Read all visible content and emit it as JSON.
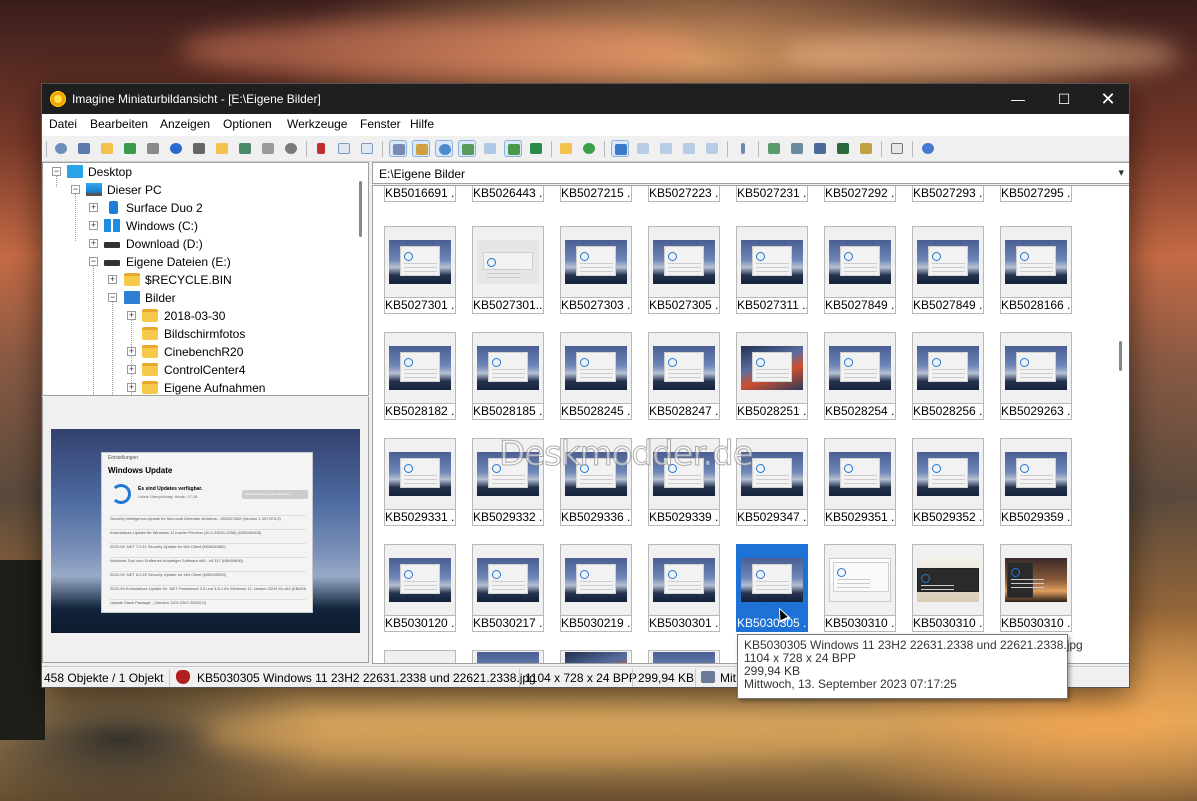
{
  "window": {
    "title": "Imagine Miniaturbildansicht - [E:\\Eigene Bilder]",
    "controls": {
      "minimize": "—",
      "maximize": "☐",
      "close": "✕"
    }
  },
  "menu": [
    "Datei",
    "Bearbeiten",
    "Anzeigen",
    "Optionen",
    "Werkzeuge",
    "Fenster",
    "Hilfe"
  ],
  "toolbar_icons": [
    "view-icon",
    "slideshow-icon",
    "open-folder-icon",
    "save-icon",
    "print-icon",
    "info-icon",
    "camera-icon",
    "folder-add-icon",
    "scan-icon",
    "bin-icon",
    "settings-icon",
    "cut-icon",
    "copy-icon",
    "paste-icon",
    "thumbnails-icon",
    "sort-icon",
    "clock-icon",
    "filter-icon",
    "grid-icon",
    "frame-icon",
    "view-mode-icon",
    "folder-up-icon",
    "refresh-icon",
    "large-thumbs-icon",
    "small-thumbs-icon",
    "list-icon",
    "details-icon",
    "report-icon",
    "tools-icon",
    "batch-icon",
    "batch-convert-icon",
    "capture-icon",
    "film-icon",
    "edit-icon",
    "notes-icon",
    "help-icon"
  ],
  "tree": {
    "items": [
      {
        "label": "Desktop",
        "icon": "desktop-icon",
        "expander": "−"
      },
      {
        "label": "Dieser PC",
        "icon": "pc-icon",
        "expander": "−"
      },
      {
        "label": "Surface Duo 2",
        "icon": "phone-icon",
        "expander": "+"
      },
      {
        "label": "Windows (C:)",
        "icon": "windows-drive-icon",
        "expander": "+"
      },
      {
        "label": "Download (D:)",
        "icon": "drive-icon",
        "expander": "+"
      },
      {
        "label": "Eigene Dateien (E:)",
        "icon": "drive-icon",
        "expander": "−"
      },
      {
        "label": "$RECYCLE.BIN",
        "icon": "folder-icon",
        "expander": "+"
      },
      {
        "label": "Bilder",
        "icon": "pictures-folder-icon",
        "expander": "−"
      },
      {
        "label": "2018-03-30",
        "icon": "folder-icon",
        "expander": "+"
      },
      {
        "label": "Bildschirmfotos",
        "icon": "folder-icon",
        "expander": ""
      },
      {
        "label": "CinebenchR20",
        "icon": "folder-icon",
        "expander": "+"
      },
      {
        "label": "ControlCenter4",
        "icon": "folder-icon",
        "expander": "+"
      },
      {
        "label": "Eigene Aufnahmen",
        "icon": "folder-icon",
        "expander": "+"
      }
    ]
  },
  "preview": {
    "window_caption": "Einstellungen",
    "heading": "Windows Update",
    "status": "Es sind Updates verfügbar.",
    "status_sub": "Letzte Überprüfung: Heute, 07:16",
    "button": "Herunterladen und alle installieren",
    "entries": [
      "Security Intelligence-Update für Microsoft Defender Antivirus - KB2267602 (Version 1.397.870.0)",
      "Kumulatives Update für Windows 11 Insider Preview (10.0.22631.2338) (KB5030305)",
      "2023-09 .NET 7.0.11 Security Update for x64 Client (KB5030560)",
      "Windows-Tool zum Entfernen bösartiger Software x64 - v5.117 (KB890830)",
      "2023-09 .NET 6.0.22 Security Update for x64 Client (KB5030559)",
      "2023-09 Kumulatives Update für .NET Framework 3.5 und 4.8.1 für Windows 11, version 22H2 für x64 (KB5030217)",
      "Update Stack Package - (Version 1201.2307.25022.0)"
    ]
  },
  "address": {
    "path": "E:\\Eigene Bilder",
    "dropdown": "▾"
  },
  "thumbnails": {
    "row0": [
      "KB5016691 ...",
      "KB5026443 ...",
      "KB5027215 ...",
      "KB5027223 ...",
      "KB5027231 ...",
      "KB5027292 ...",
      "KB5027293 ...",
      "KB5027295 ..."
    ],
    "row1": [
      "KB5027301 ...",
      "KB5027301....",
      "KB5027303 ...",
      "KB5027305 ...",
      "KB5027311 ...",
      "KB5027849 ...",
      "KB5027849 ...",
      "KB5028166 ..."
    ],
    "row2": [
      "KB5028182 ...",
      "KB5028185 ...",
      "KB5028245 ...",
      "KB5028247 ...",
      "KB5028251 ...",
      "KB5028254 ...",
      "KB5028256 ...",
      "KB5029263 ..."
    ],
    "row3": [
      "KB5029331 ...",
      "KB5029332 ...",
      "KB5029336 ...",
      "KB5029339 ...",
      "KB5029347 ...",
      "KB5029351 ...",
      "KB5029352 ...",
      "KB5029359 ..."
    ],
    "row4": [
      "KB5030120 ...",
      "KB5030217 ...",
      "KB5030219 ...",
      "KB5030301 ...",
      "KB5030305 ...",
      "KB5030310 ...",
      "KB5030310 ...",
      "KB5030310 ..."
    ],
    "selected_label": "KB5030305 ..."
  },
  "watermark": "Deskmodder.de",
  "status": {
    "count": "458 Objekte / 1 Objekt",
    "file": "KB5030305 Windows 11 23H2 22631.2338 und 22621.2338.jpg",
    "dimensions": "1104 x 728 x 24 BPP",
    "size": "299,94 KB",
    "date": "Mit"
  },
  "tooltip": {
    "name": "KB5030305 Windows 11 23H2 22631.2338 und 22621.2338.jpg",
    "dimensions": "1104 x 728 x 24 BPP",
    "size": "299,94 KB",
    "date": "Mittwoch, 13. September 2023 07:17:25"
  }
}
